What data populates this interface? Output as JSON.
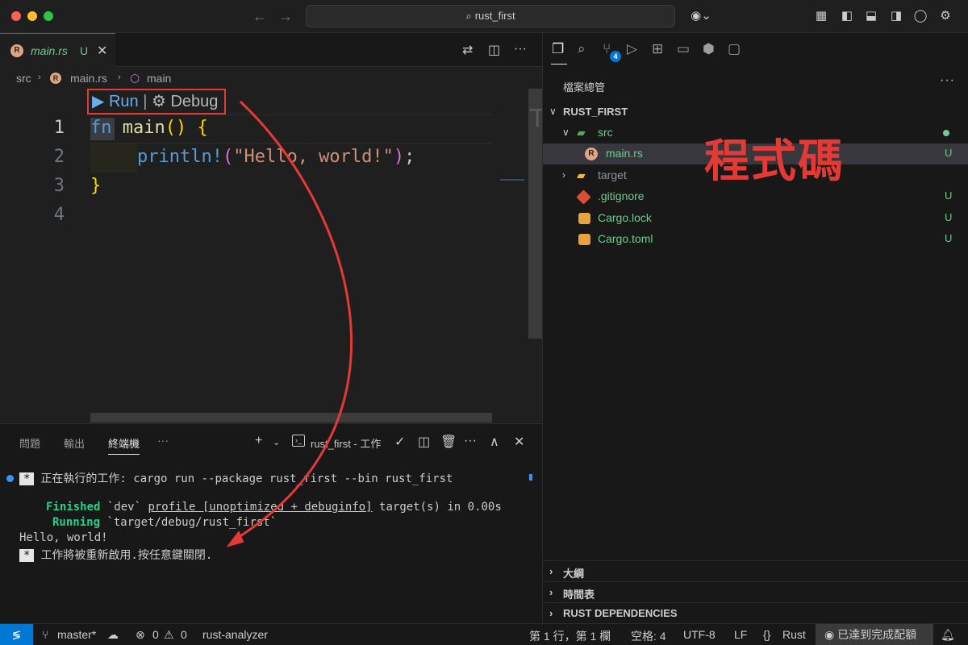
{
  "window": {
    "search_text": "rust_first"
  },
  "editor": {
    "tab": {
      "filename": "main.rs",
      "status": "U"
    },
    "breadcrumb": [
      "src",
      "main.rs",
      "main"
    ],
    "codelens": {
      "run": "Run",
      "separator": "|",
      "debug": "Debug"
    },
    "line_numbers": [
      "1",
      "2",
      "3",
      "4"
    ],
    "code": {
      "l1_kw": "fn",
      "l1_name": "main",
      "l1_parens": "()",
      "l1_brace": "{",
      "l2_macro": "println!",
      "l2_open": "(",
      "l2_str": "\"Hello, world!\"",
      "l2_close": ")",
      "l2_semi": ";",
      "l3_brace": "}"
    }
  },
  "panel": {
    "tabs": [
      "問題",
      "輸出",
      "終端機"
    ],
    "more": "···",
    "terminal_name": "rust_first - 工作",
    "lines": {
      "task": "正在執行的工作: cargo run --package rust_first --bin rust_first",
      "finished_label": "Finished",
      "finished_rest_1": " `dev` ",
      "finished_underlined": "profile [unoptimized + debuginfo]",
      "finished_rest_2": " target(s) in 0.00s",
      "running_label": "Running",
      "running_rest": " `target/debug/rust_first`",
      "hello": "Hello, world!",
      "restart": "工作將被重新啟用.按任意鍵關閉.",
      "star": "*"
    }
  },
  "sidebar": {
    "title": "檔案總管",
    "more": "···",
    "scm_badge": "4",
    "root": "RUST_FIRST",
    "tree": [
      {
        "name": "src",
        "status": ""
      },
      {
        "name": "main.rs",
        "status": "U"
      },
      {
        "name": "target",
        "status": ""
      },
      {
        "name": ".gitignore",
        "status": "U"
      },
      {
        "name": "Cargo.lock",
        "status": "U"
      },
      {
        "name": "Cargo.toml",
        "status": "U"
      }
    ],
    "sections": [
      "大綱",
      "時間表",
      "RUST DEPENDENCIES"
    ]
  },
  "statusbar": {
    "branch": "master*",
    "errors": "0",
    "warnings": "0",
    "language_server": "rust-analyzer",
    "position": "第 1 行，第 1 欄",
    "spaces": "空格: 4",
    "encoding": "UTF-8",
    "eol": "LF",
    "braces": "{}",
    "language": "Rust",
    "sync": "已達到完成配額"
  },
  "annotation": {
    "label": "程式碼"
  },
  "colors": {
    "accent": "#0078d4",
    "annotation_red": "#e53935",
    "untracked_green": "#73c991"
  }
}
